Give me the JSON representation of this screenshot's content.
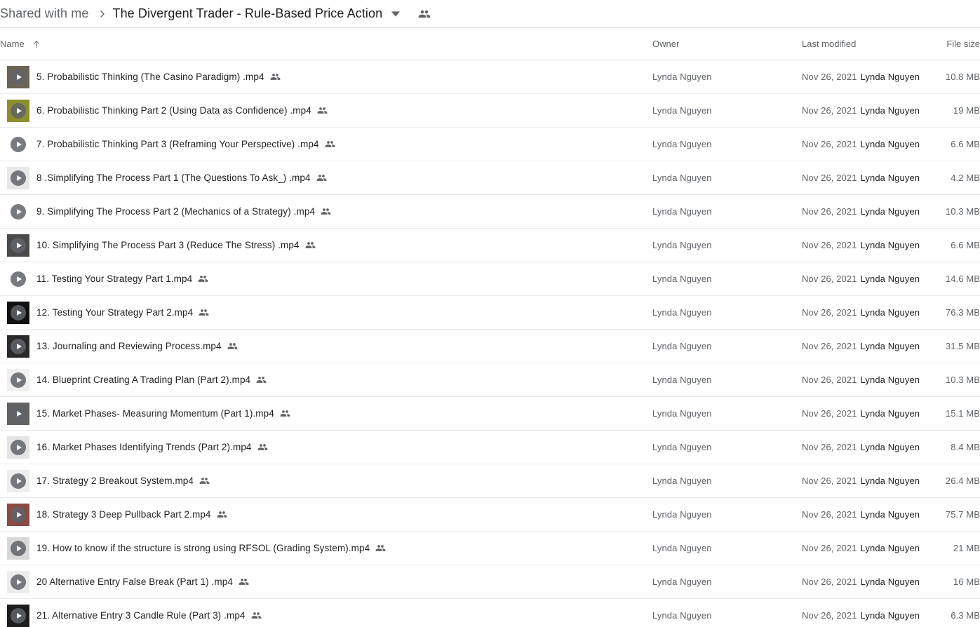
{
  "header": {
    "breadcrumb_root": "Shared with me",
    "breadcrumb_separator": "›",
    "breadcrumb_current": "The Divergent Trader - Rule-Based Price Action",
    "caret_icon": "chevron-down-icon",
    "people_icon": "people-shared-icon"
  },
  "columns": {
    "name": "Name",
    "sort_arrow": "↑",
    "owner": "Owner",
    "last_modified": "Last modified",
    "file_size": "File size"
  },
  "colors": {
    "text_primary": "#202124",
    "text_secondary": "#5f6368",
    "row_divider": "#e8eaed",
    "header_divider": "#e0e0e0",
    "thumb_placeholder": "#efefef",
    "play_button": "#5f6368"
  },
  "rows": [
    {
      "name": "5. Probabilistic Thinking (The Casino Paradigm) .mp4",
      "shared": "people-shared-icon",
      "owner": "Lynda Nguyen",
      "modified_date": "Nov 26, 2021",
      "modified_by": "Lynda Nguyen",
      "size": "10.8 MB",
      "thumb": "#6b6358"
    },
    {
      "name": "6. Probabilistic Thinking Part 2 (Using Data as Confidence) .mp4",
      "shared": "people-shared-icon",
      "owner": "Lynda Nguyen",
      "modified_date": "Nov 26, 2021",
      "modified_by": "Lynda Nguyen",
      "size": "19 MB",
      "thumb": "#8d8f2e"
    },
    {
      "name": "7. Probabilistic Thinking Part 3 (Reframing Your Perspective) .mp4",
      "shared": "people-shared-icon",
      "owner": "Lynda Nguyen",
      "modified_date": "Nov 26, 2021",
      "modified_by": "Lynda Nguyen",
      "size": "6.6 MB",
      "thumb": "#ffffff"
    },
    {
      "name": "8 .Simplifying The Process Part 1 (The Questions To Ask_) .mp4",
      "shared": "people-shared-icon",
      "owner": "Lynda Nguyen",
      "modified_date": "Nov 26, 2021",
      "modified_by": "Lynda Nguyen",
      "size": "4.2 MB",
      "thumb": "#e8e8e8"
    },
    {
      "name": "9. Simplifying The Process Part 2 (Mechanics of a Strategy) .mp4",
      "shared": "people-shared-icon",
      "owner": "Lynda Nguyen",
      "modified_date": "Nov 26, 2021",
      "modified_by": "Lynda Nguyen",
      "size": "10.3 MB",
      "thumb": "#ffffff"
    },
    {
      "name": "10. Simplifying The Process Part 3 (Reduce The Stress) .mp4",
      "shared": "people-shared-icon",
      "owner": "Lynda Nguyen",
      "modified_date": "Nov 26, 2021",
      "modified_by": "Lynda Nguyen",
      "size": "6.6 MB",
      "thumb": "#4a4a4a"
    },
    {
      "name": "11. Testing Your Strategy Part 1.mp4",
      "shared": "people-shared-icon",
      "owner": "Lynda Nguyen",
      "modified_date": "Nov 26, 2021",
      "modified_by": "Lynda Nguyen",
      "size": "14.6 MB",
      "thumb": "#ffffff"
    },
    {
      "name": "12. Testing Your Strategy Part 2.mp4",
      "shared": "people-shared-icon",
      "owner": "Lynda Nguyen",
      "modified_date": "Nov 26, 2021",
      "modified_by": "Lynda Nguyen",
      "size": "76.3 MB",
      "thumb": "#111111"
    },
    {
      "name": "13. Journaling and Reviewing Process.mp4",
      "shared": "people-shared-icon",
      "owner": "Lynda Nguyen",
      "modified_date": "Nov 26, 2021",
      "modified_by": "Lynda Nguyen",
      "size": "31.5 MB",
      "thumb": "#2a2a2a"
    },
    {
      "name": "14. Blueprint Creating A Trading Plan (Part 2).mp4",
      "shared": "people-shared-icon",
      "owner": "Lynda Nguyen",
      "modified_date": "Nov 26, 2021",
      "modified_by": "Lynda Nguyen",
      "size": "10.3 MB",
      "thumb": "#f0f0f0"
    },
    {
      "name": "15. Market Phases- Measuring Momentum (Part 1).mp4",
      "shared": "people-shared-icon",
      "owner": "Lynda Nguyen",
      "modified_date": "Nov 26, 2021",
      "modified_by": "Lynda Nguyen",
      "size": "15.1 MB",
      "thumb": "#626262"
    },
    {
      "name": "16. Market Phases Identifying Trends (Part 2).mp4",
      "shared": "people-shared-icon",
      "owner": "Lynda Nguyen",
      "modified_date": "Nov 26, 2021",
      "modified_by": "Lynda Nguyen",
      "size": "8.4 MB",
      "thumb": "#e4e4e4"
    },
    {
      "name": "17. Strategy 2 Breakout System.mp4",
      "shared": "people-shared-icon",
      "owner": "Lynda Nguyen",
      "modified_date": "Nov 26, 2021",
      "modified_by": "Lynda Nguyen",
      "size": "26.4 MB",
      "thumb": "#ededed"
    },
    {
      "name": "18. Strategy 3 Deep Pullback Part 2.mp4",
      "shared": "people-shared-icon",
      "owner": "Lynda Nguyen",
      "modified_date": "Nov 26, 2021",
      "modified_by": "Lynda Nguyen",
      "size": "75.7 MB",
      "thumb": "#8a4b44"
    },
    {
      "name": "19. How to know if the structure is strong using RFSOL (Grading System).mp4",
      "shared": "people-shared-icon",
      "owner": "Lynda Nguyen",
      "modified_date": "Nov 26, 2021",
      "modified_by": "Lynda Nguyen",
      "size": "21 MB",
      "thumb": "#d8d8d8"
    },
    {
      "name": "20 Alternative Entry False Break (Part 1) .mp4",
      "shared": "people-shared-icon",
      "owner": "Lynda Nguyen",
      "modified_date": "Nov 26, 2021",
      "modified_by": "Lynda Nguyen",
      "size": "16 MB",
      "thumb": "#ececec"
    },
    {
      "name": "21. Alternative Entry 3 Candle Rule (Part 3) .mp4",
      "shared": "people-shared-icon",
      "owner": "Lynda Nguyen",
      "modified_date": "Nov 26, 2021",
      "modified_by": "Lynda Nguyen",
      "size": "6.3 MB",
      "thumb": "#1d1d1d"
    }
  ]
}
